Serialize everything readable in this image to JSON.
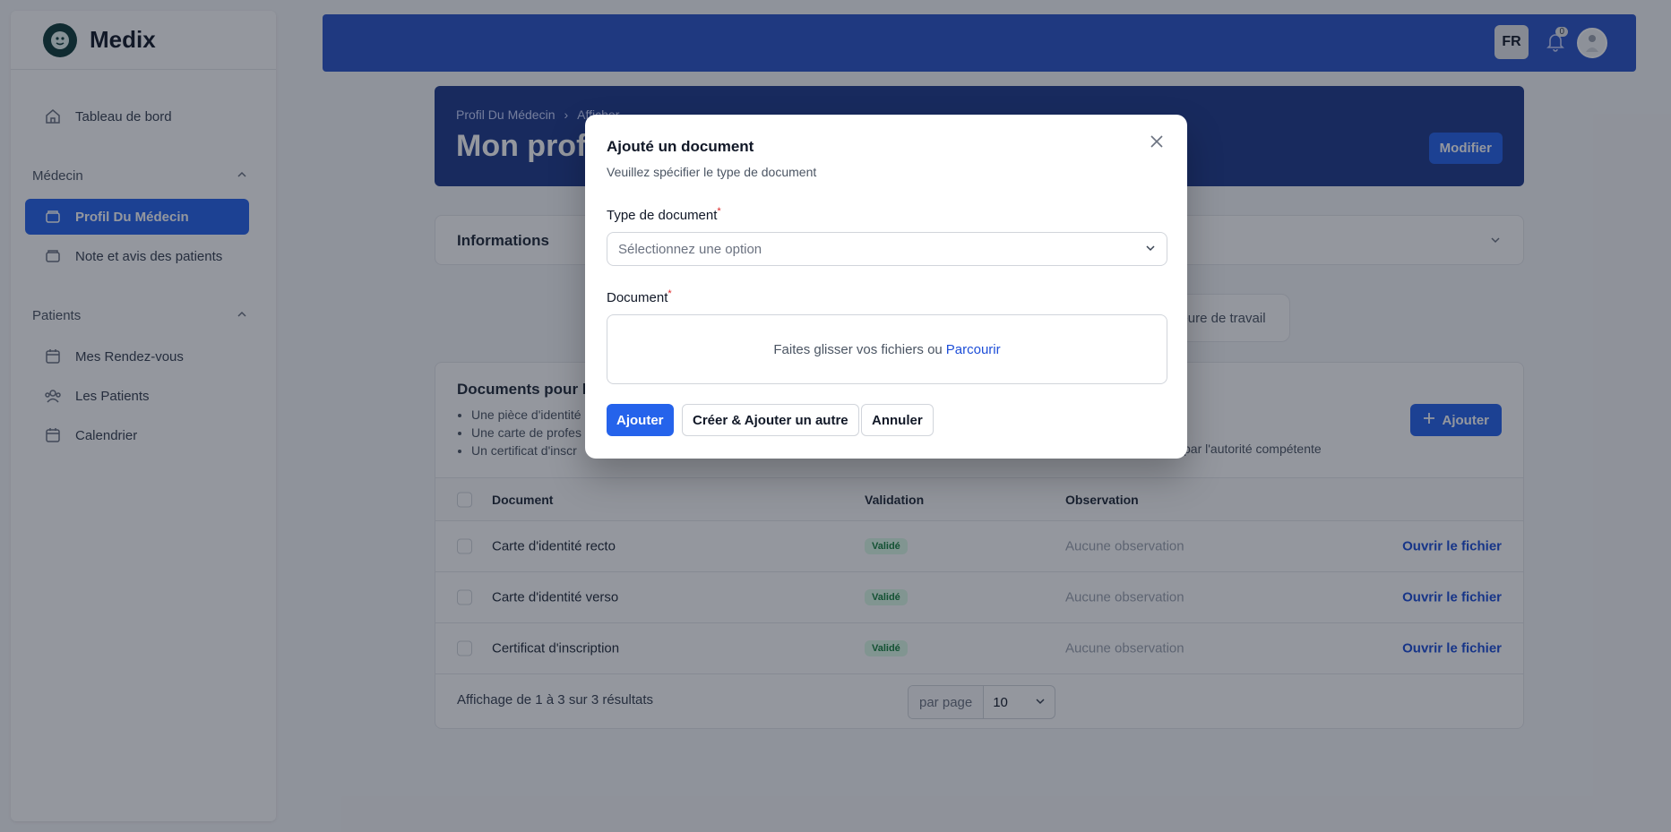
{
  "brand": {
    "name": "Medix"
  },
  "sidebar": {
    "dashboard": "Tableau de bord",
    "groups": [
      {
        "label": "Médecin",
        "items": [
          "Profil Du Médecin",
          "Note et avis des patients"
        ]
      },
      {
        "label": "Patients",
        "items": [
          "Mes Rendez-vous",
          "Les Patients",
          "Calendrier"
        ]
      }
    ]
  },
  "topbar": {
    "language": "FR",
    "notification_count": "0"
  },
  "header": {
    "breadcrumb": [
      "Profil Du Médecin",
      "Afficher"
    ],
    "title": "Mon profil",
    "edit_label": "Modifier"
  },
  "info_section": {
    "title": "Informations"
  },
  "tab_visible": "eure de travail",
  "documents": {
    "title": "Documents pour la",
    "requirements": [
      "Une pièce d'identité",
      "Une carte de profes",
      "Un certificat d'inscr"
    ],
    "requirement_tail": "par l'autorité compétente",
    "add_label": "Ajouter",
    "columns": [
      "Document",
      "Validation",
      "Observation"
    ],
    "rows": [
      {
        "document": "Carte d'identité recto",
        "validation": "Validé",
        "observation": "Aucune observation",
        "action": "Ouvrir le fichier"
      },
      {
        "document": "Carte d'identité verso",
        "validation": "Validé",
        "observation": "Aucune observation",
        "action": "Ouvrir le fichier"
      },
      {
        "document": "Certificat d'inscription",
        "validation": "Validé",
        "observation": "Aucune observation",
        "action": "Ouvrir le fichier"
      }
    ],
    "summary": "Affichage de 1 à 3 sur 3 résultats",
    "per_page_label": "par page",
    "per_page_value": "10"
  },
  "modal": {
    "title": "Ajouté un document",
    "subtitle": "Veuillez spécifier le type de document",
    "type_label": "Type de document",
    "type_placeholder": "Sélectionnez une option",
    "document_label": "Document",
    "dropzone_text": "Faites glisser vos fichiers ou",
    "dropzone_link": "Parcourir",
    "submit": "Ajouter",
    "submit_another": "Créer & Ajouter un autre",
    "cancel": "Annuler"
  },
  "colors": {
    "primary": "#2563eb",
    "topbar": "#2a55c9",
    "header": "#1e3a8a"
  }
}
